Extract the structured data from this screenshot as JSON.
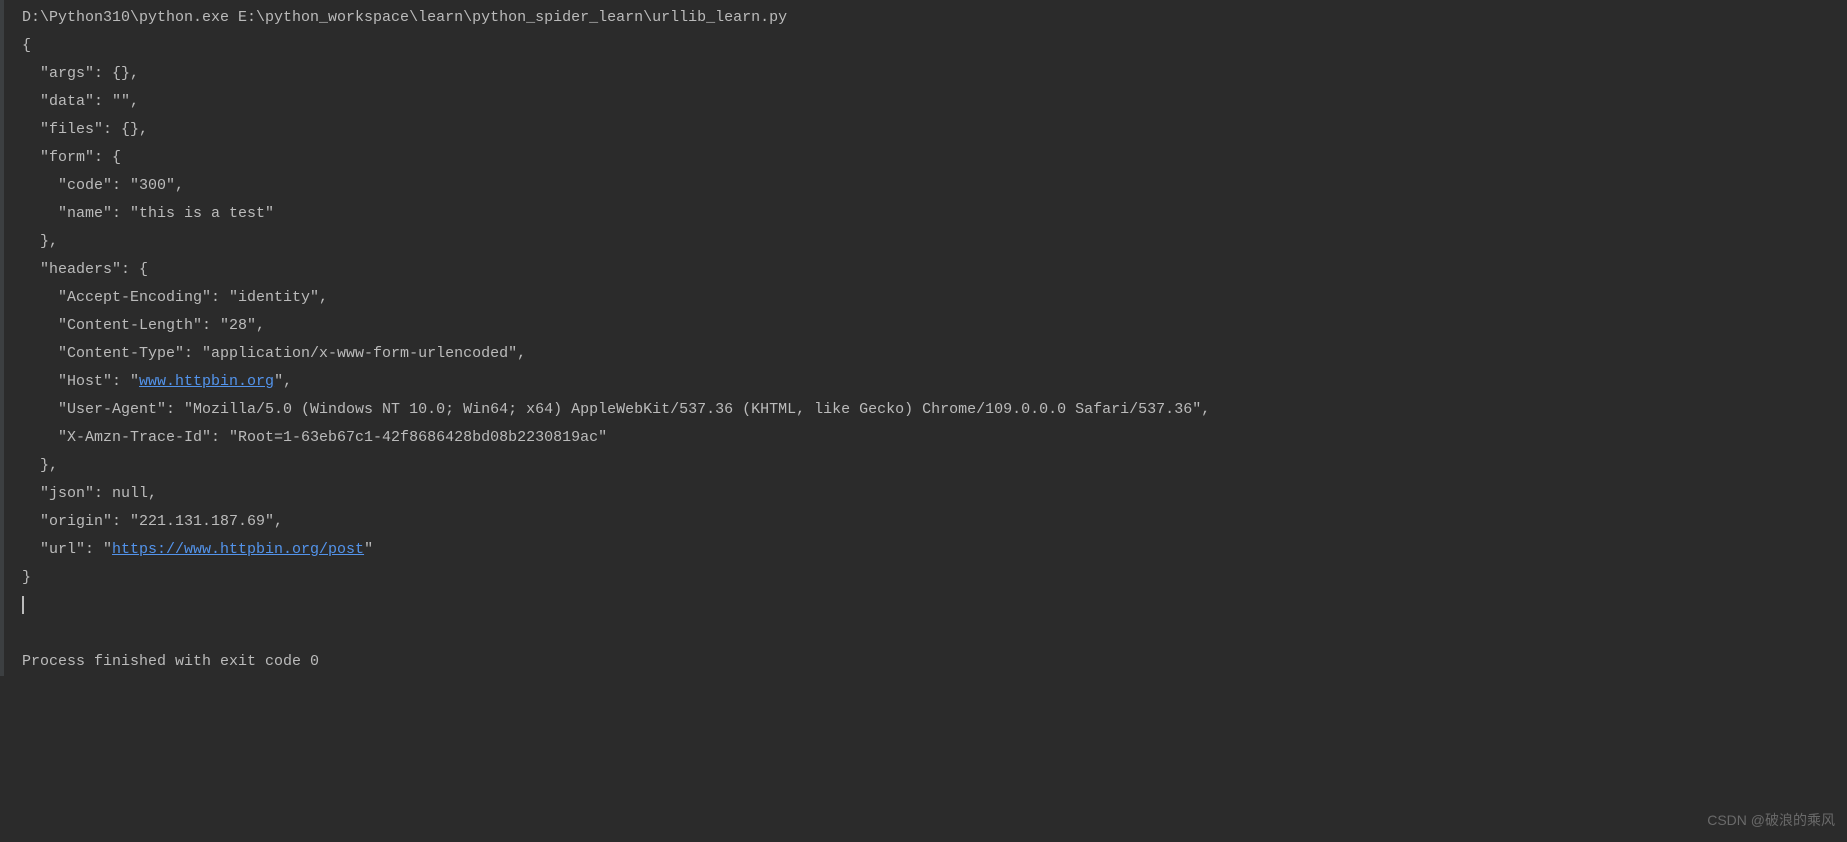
{
  "console": {
    "command_line": "D:\\Python310\\python.exe E:\\python_workspace\\learn\\python_spider_learn\\urllib_learn.py",
    "lines": {
      "l1": "{",
      "l2": "  \"args\": {}, ",
      "l3": "  \"data\": \"\", ",
      "l4": "  \"files\": {}, ",
      "l5": "  \"form\": {",
      "l6": "    \"code\": \"300\", ",
      "l7": "    \"name\": \"this is a test\"",
      "l8": "  }, ",
      "l9": "  \"headers\": {",
      "l10": "    \"Accept-Encoding\": \"identity\", ",
      "l11": "    \"Content-Length\": \"28\", ",
      "l12": "    \"Content-Type\": \"application/x-www-form-urlencoded\", ",
      "l13a": "    \"Host\": \"",
      "l13link": "www.httpbin.org",
      "l13b": "\", ",
      "l14": "    \"User-Agent\": \"Mozilla/5.0 (Windows NT 10.0; Win64; x64) AppleWebKit/537.36 (KHTML, like Gecko) Chrome/109.0.0.0 Safari/537.36\", ",
      "l15": "    \"X-Amzn-Trace-Id\": \"Root=1-63eb67c1-42f8686428bd08b2230819ac\"",
      "l16": "  }, ",
      "l17": "  \"json\": null, ",
      "l18": "  \"origin\": \"221.131.187.69\", ",
      "l19a": "  \"url\": \"",
      "l19link": "https://www.httpbin.org/post",
      "l19b": "\"",
      "l20": "}"
    },
    "exit_message": "Process finished with exit code 0"
  },
  "watermark": "CSDN @破浪的乘风"
}
